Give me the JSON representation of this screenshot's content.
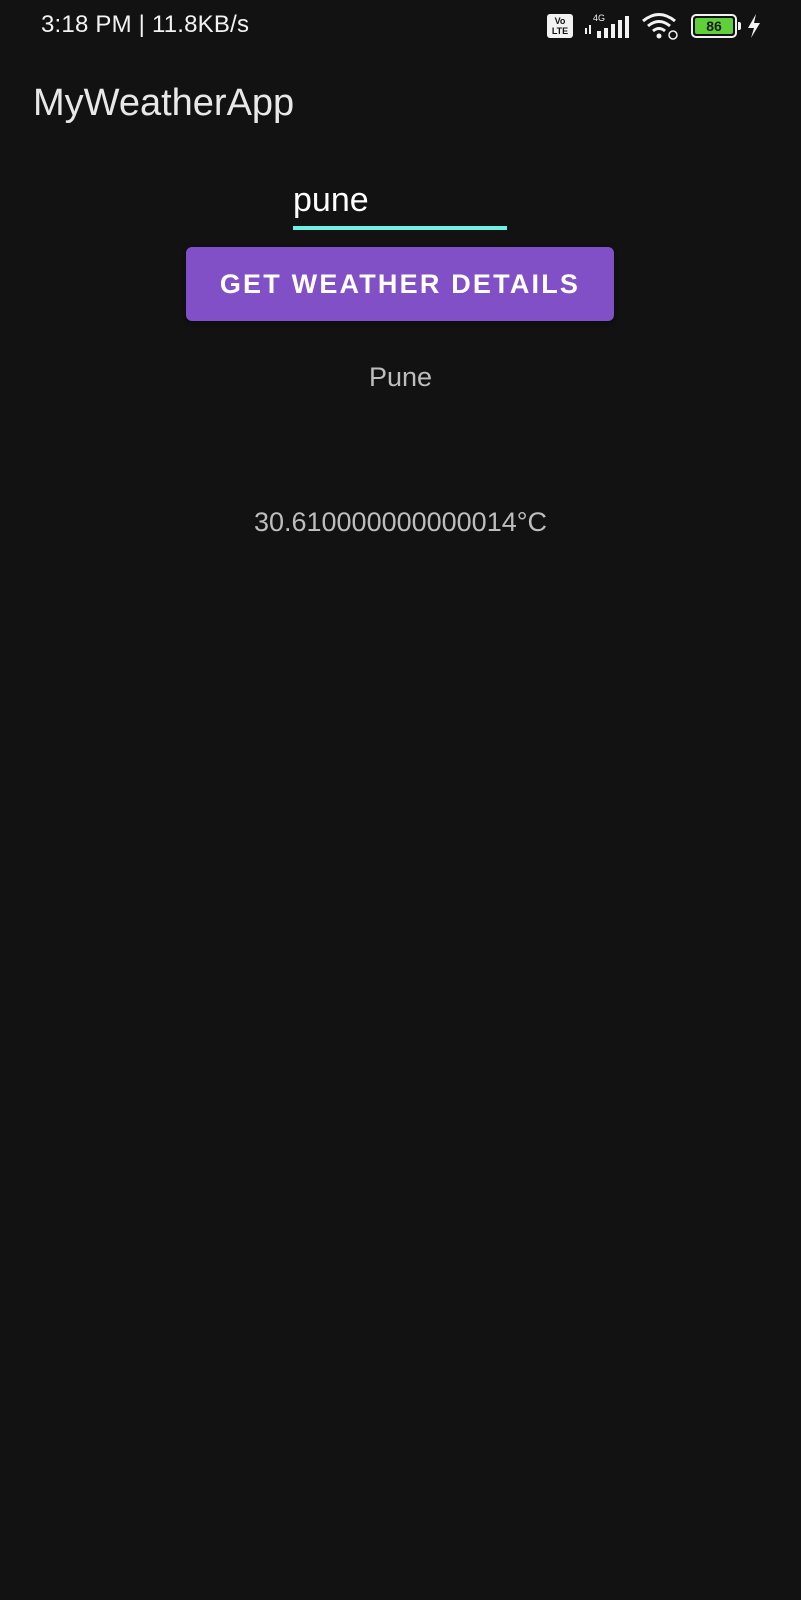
{
  "status_bar": {
    "time_speed": "3:18 PM | 11.8KB/s",
    "volte_label": "Vo LTE",
    "network_label": "4G",
    "battery_level": "86",
    "icons": [
      "volte-icon",
      "signal-icon",
      "wifi-icon",
      "battery-icon",
      "charging-icon"
    ],
    "battery_color": "#5fcf3a"
  },
  "app_bar": {
    "title": "MyWeatherApp"
  },
  "search": {
    "value": "pune",
    "underline_color": "#6ff0e0"
  },
  "button": {
    "label": "GET WEATHER DETAILS",
    "color": "#8150c7"
  },
  "result": {
    "city": "Pune",
    "temperature": "30.610000000000014°C"
  }
}
